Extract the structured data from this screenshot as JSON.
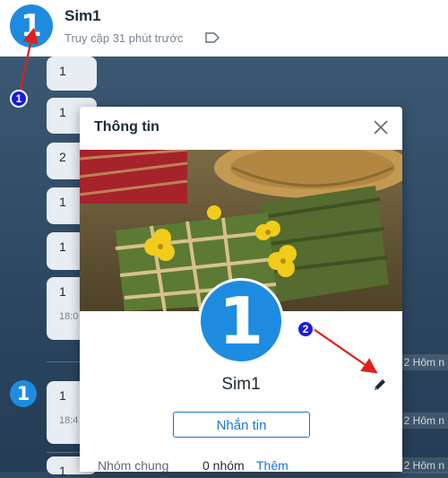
{
  "header": {
    "avatar_text": "1",
    "name": "Sim1",
    "status": "Truy cập 31 phút trước"
  },
  "chat": {
    "messages": [
      {
        "text": "1"
      },
      {
        "text": "1"
      },
      {
        "text": "2"
      },
      {
        "text": "1"
      },
      {
        "text": "1"
      },
      {
        "text": "1",
        "time": "18:0"
      }
    ],
    "second_avatar_text": "1",
    "second_messages": [
      {
        "text": "1",
        "time": "18:4"
      },
      {
        "text": "1"
      }
    ],
    "date_labels": [
      "2 Hôm n",
      "2 Hôm n",
      "2 Hôm n"
    ]
  },
  "modal": {
    "title": "Thông tin",
    "avatar_text": "1",
    "name": "Sim1",
    "message_button": "Nhắn tin",
    "group_label": "Nhóm chung",
    "group_count": "0 nhóm",
    "group_add": "Thêm"
  },
  "annotations": {
    "badge_1": "1",
    "badge_2": "2"
  },
  "colors": {
    "accent": "#1a74d8",
    "avatar": "#1d8ce0",
    "annotation_arrow": "#e0201a",
    "annotation_badge": "#1a1ae0"
  }
}
